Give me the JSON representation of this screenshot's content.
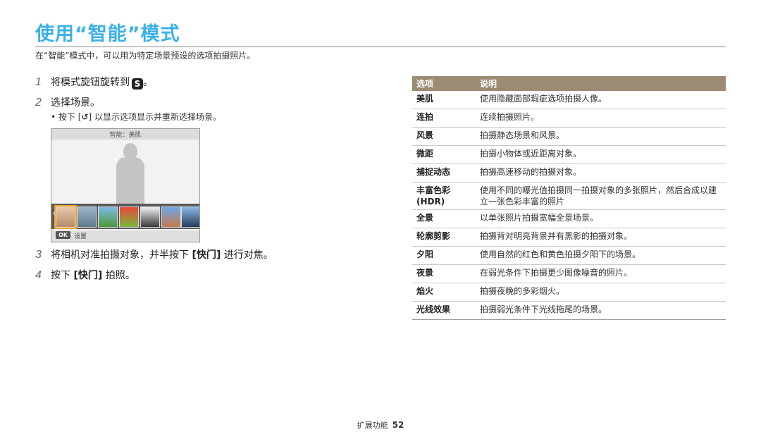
{
  "page": {
    "title": "使用“智能”模式",
    "intro": "在“智能”模式中，可以用为特定场景预设的选项拍摄照片。"
  },
  "steps": [
    {
      "num": "1",
      "text_before": "将模式旋钮旋转到",
      "icon": "s-mode-icon",
      "icon_label": "S",
      "text_after": "。"
    },
    {
      "num": "2",
      "text": "选择场景。"
    },
    {
      "num": "3",
      "text_before": "将相机对准拍摄对象，并半按下",
      "key": "[快门]",
      "text_after": "进行对焦。"
    },
    {
      "num": "4",
      "text_before": "按下",
      "key": "[快门]",
      "text_after": "拍照。"
    }
  ],
  "bullet": {
    "prefix": "按下 [",
    "icon": "back-icon",
    "icon_glyph": "↺",
    "suffix": "] 以显示选项显示并重新选择场景。"
  },
  "camera_screen": {
    "caption": "智能：美肌",
    "ok_label": "OK",
    "settings_label": "设置"
  },
  "table": {
    "headers": [
      "选项",
      "说明"
    ],
    "rows": [
      {
        "option": "美肌",
        "description": "使用隐藏面部瑕疵选项拍摄人像。"
      },
      {
        "option": "连拍",
        "description": "连续拍摄照片。"
      },
      {
        "option": "风景",
        "description": "拍摄静态场景和风景。"
      },
      {
        "option": "微距",
        "description": "拍摄小物体或近距离对象。"
      },
      {
        "option": "捕捉动态",
        "description": "拍摄高速移动的拍摄对象。"
      },
      {
        "option": "丰富色彩 (HDR)",
        "description": "使用不同的曝光值拍摄同一拍摄对象的多张照片，然后合成以建立一张色彩丰富的照片"
      },
      {
        "option": "全景",
        "description": "以单张照片拍摄宽幅全景场景。"
      },
      {
        "option": "轮廓剪影",
        "description": "拍摄背对明亮背景并有黑影的拍摄对象。"
      },
      {
        "option": "夕阳",
        "description": "使用自然的红色和黄色拍摄夕阳下的场景。"
      },
      {
        "option": "夜景",
        "description": "在弱光条件下拍摄更少图像噪音的照片。"
      },
      {
        "option": "焰火",
        "description": "拍摄夜晚的多彩烟火。"
      },
      {
        "option": "光线效果",
        "description": "拍摄弱光条件下光线拖尾的场景。"
      }
    ]
  },
  "footer": {
    "section": "扩展功能",
    "page_number": "52"
  },
  "colors": {
    "title": "#3ab0e8",
    "table_header": "#9b8b73"
  }
}
